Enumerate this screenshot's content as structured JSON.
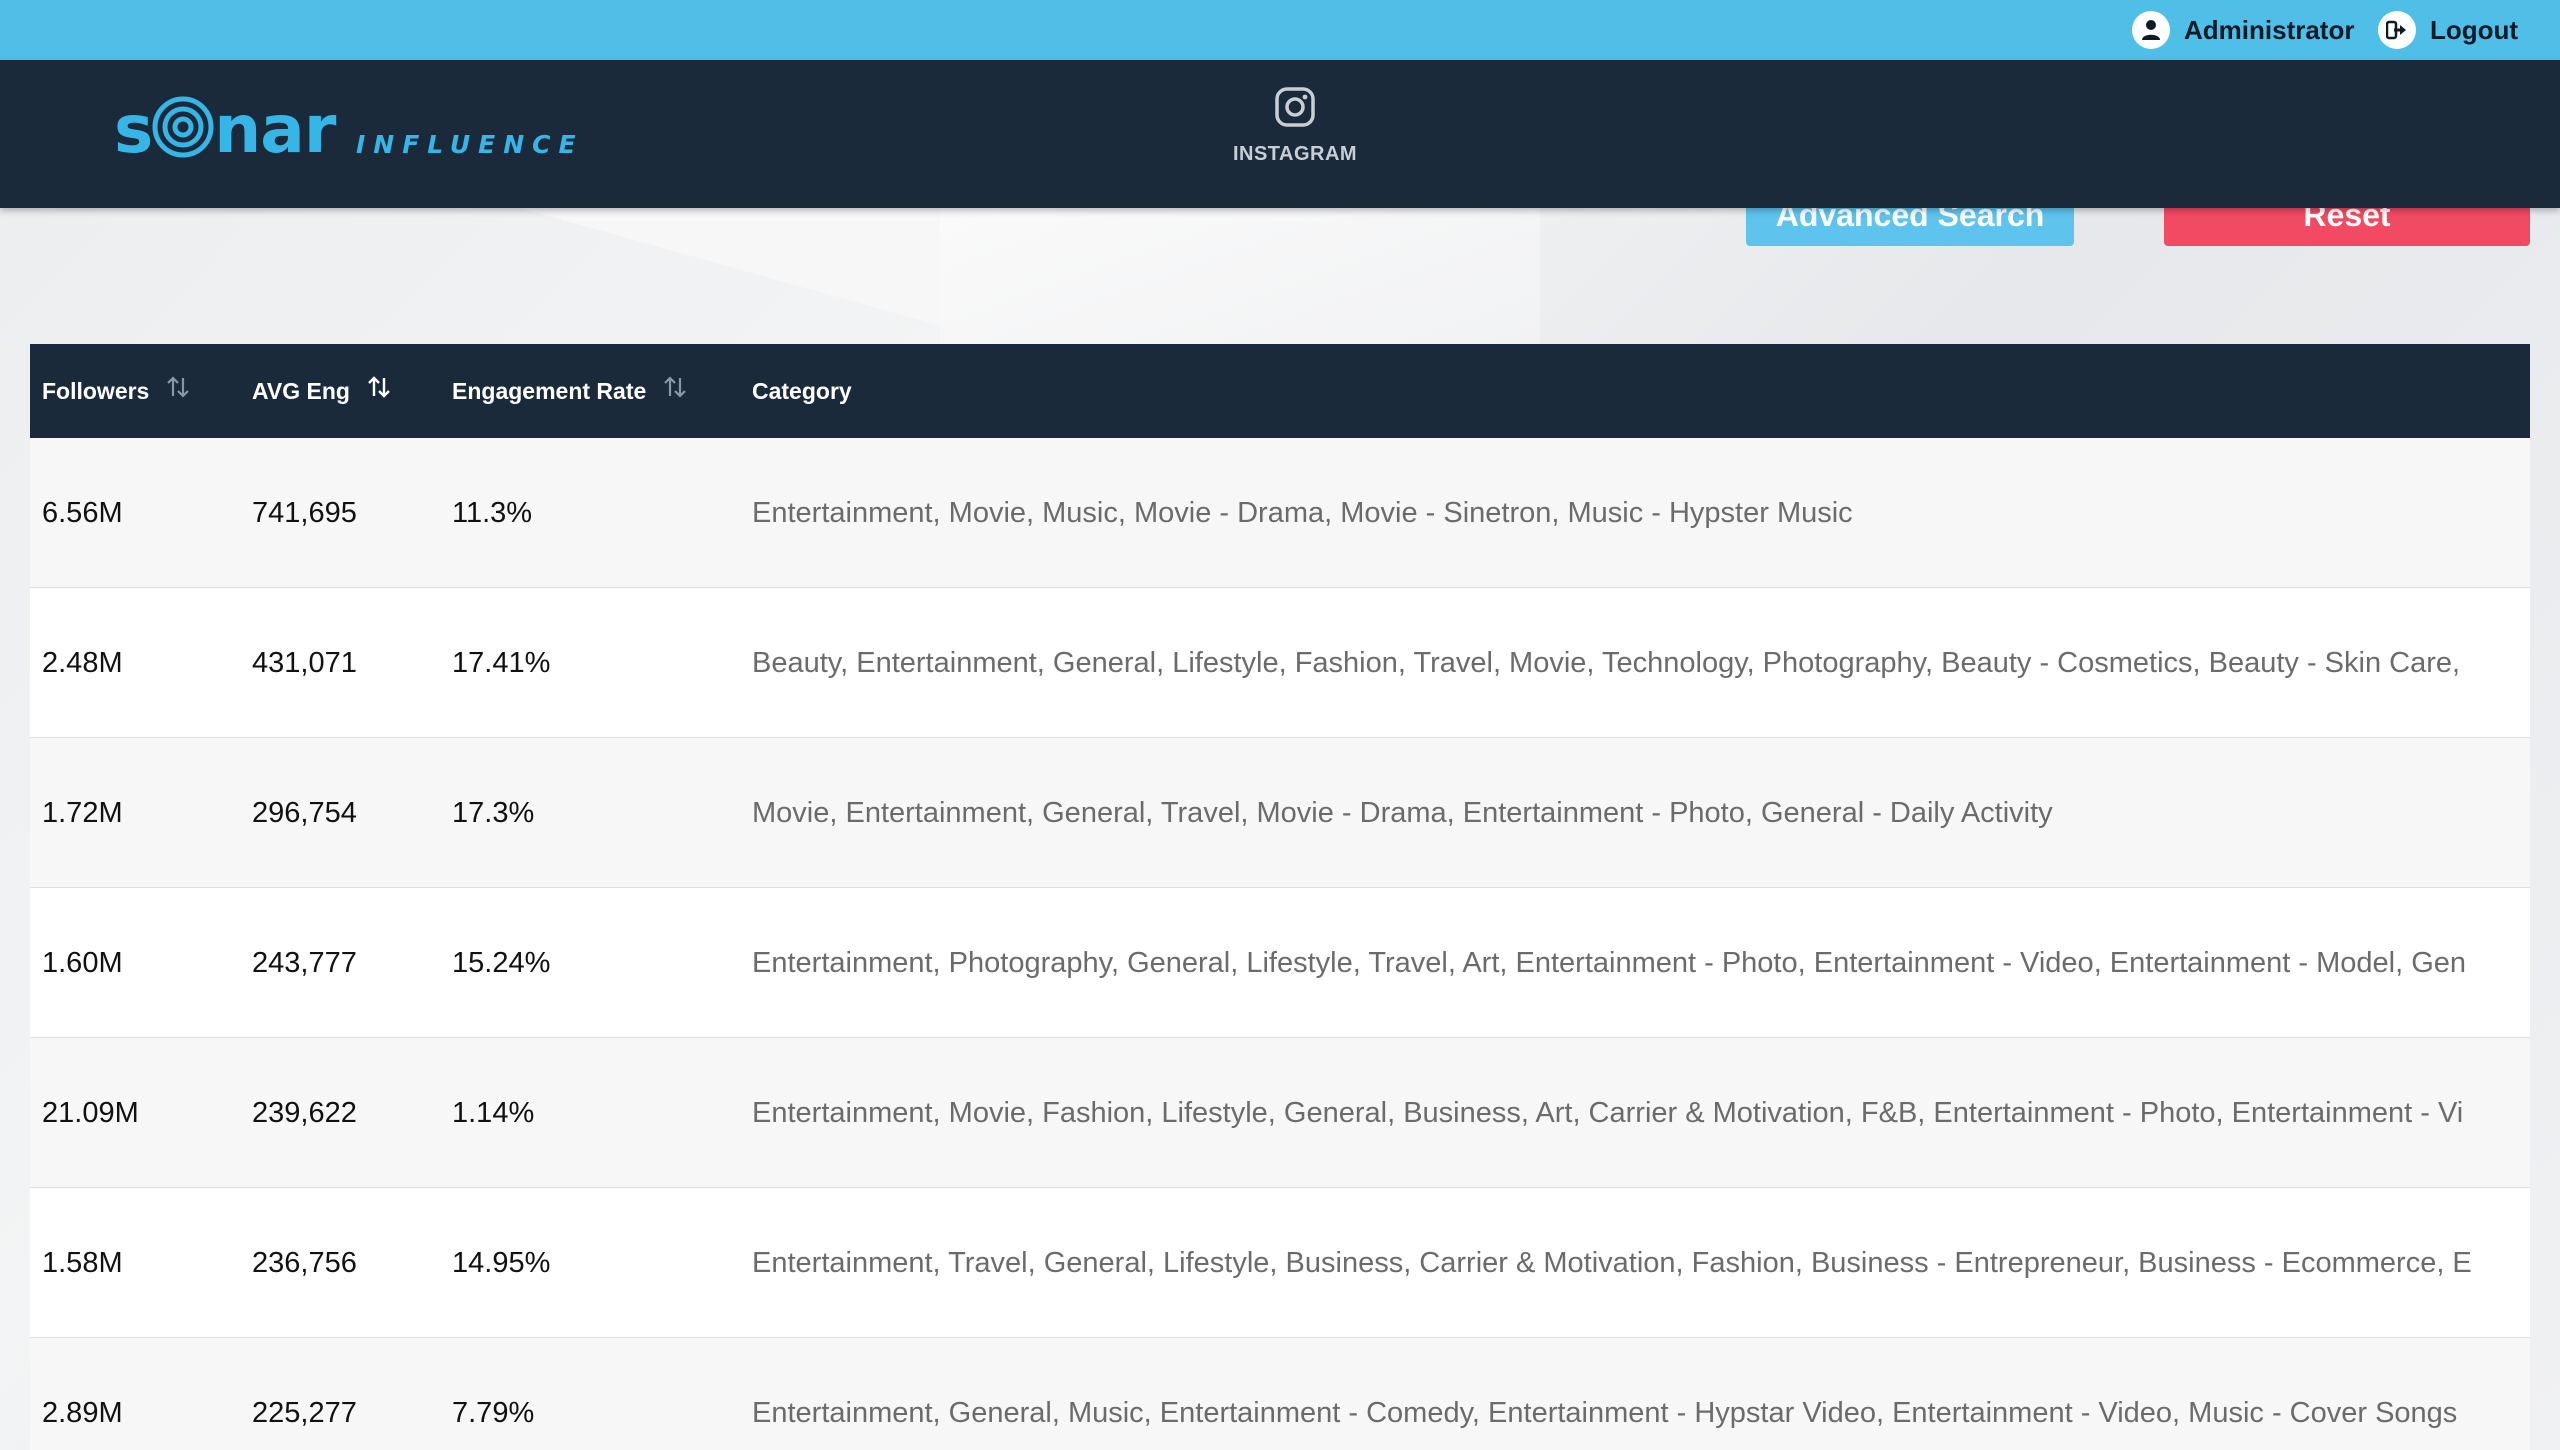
{
  "topbar": {
    "user_label": "Administrator",
    "logout_label": "Logout"
  },
  "header": {
    "logo_text": "sonar",
    "logo_sub": "INFLUENCE",
    "nav": {
      "instagram_label": "INSTAGRAM"
    }
  },
  "filters": {
    "advanced_search_label": "Advanced Search",
    "reset_label": "Reset"
  },
  "table": {
    "columns": [
      {
        "label": "Followers",
        "sortable": true
      },
      {
        "label": "AVG Eng",
        "sortable": true
      },
      {
        "label": "Engagement Rate",
        "sortable": true
      },
      {
        "label": "Category",
        "sortable": false
      }
    ],
    "rows": [
      {
        "followers": "6.56M",
        "avg_eng": "741,695",
        "rate": "11.3%",
        "category": "Entertainment, Movie, Music, Movie - Drama, Movie - Sinetron, Music - Hypster Music"
      },
      {
        "followers": "2.48M",
        "avg_eng": "431,071",
        "rate": "17.41%",
        "category": "Beauty, Entertainment, General, Lifestyle, Fashion, Travel, Movie, Technology, Photography, Beauty - Cosmetics, Beauty - Skin Care,"
      },
      {
        "followers": "1.72M",
        "avg_eng": "296,754",
        "rate": "17.3%",
        "category": "Movie, Entertainment, General, Travel, Movie - Drama, Entertainment - Photo, General - Daily Activity"
      },
      {
        "followers": "1.60M",
        "avg_eng": "243,777",
        "rate": "15.24%",
        "category": "Entertainment, Photography, General, Lifestyle, Travel, Art, Entertainment - Photo, Entertainment - Video, Entertainment - Model, Gen"
      },
      {
        "followers": "21.09M",
        "avg_eng": "239,622",
        "rate": "1.14%",
        "category": "Entertainment, Movie, Fashion, Lifestyle, General, Business, Art, Carrier & Motivation, F&B, Entertainment - Photo, Entertainment - Vi"
      },
      {
        "followers": "1.58M",
        "avg_eng": "236,756",
        "rate": "14.95%",
        "category": "Entertainment, Travel, General, Lifestyle, Business, Carrier & Motivation, Fashion, Business - Entrepreneur, Business - Ecommerce, E"
      },
      {
        "followers": "2.89M",
        "avg_eng": "225,277",
        "rate": "7.79%",
        "category": "Entertainment, General, Music, Entertainment - Comedy, Entertainment - Hypstar Video, Entertainment - Video, Music - Cover Songs"
      }
    ]
  },
  "colors": {
    "topbar": "#4fbfe8",
    "header": "#1b2a3b",
    "brand": "#35b6e6",
    "advanced_search": "#5ec4ee",
    "reset": "#f24a63"
  }
}
